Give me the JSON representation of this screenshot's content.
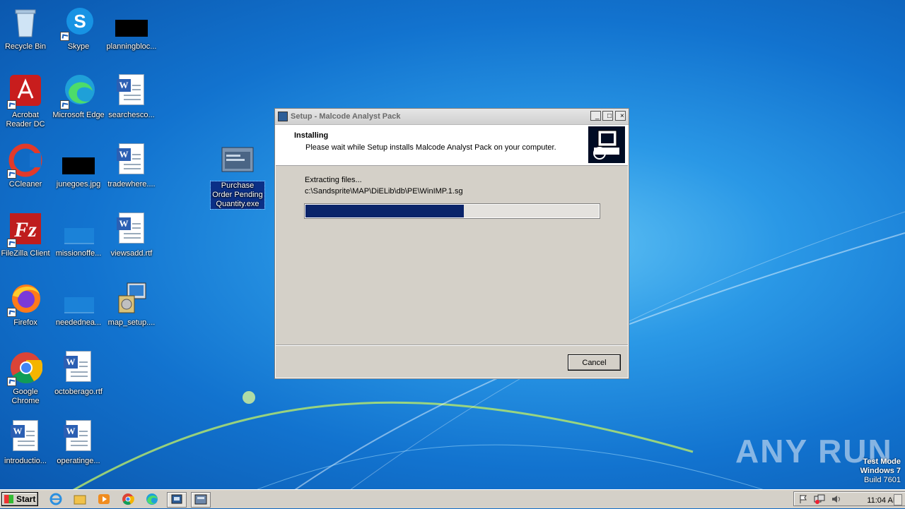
{
  "desktop": {
    "icons": [
      {
        "label": "Recycle Bin",
        "icon": "recycle-bin-icon"
      },
      {
        "label": "Skype",
        "icon": "skype-icon"
      },
      {
        "label": "planningbloc...",
        "icon": "image-file-icon"
      },
      {
        "label": "Acrobat Reader DC",
        "icon": "acrobat-icon"
      },
      {
        "label": "Microsoft Edge",
        "icon": "edge-icon"
      },
      {
        "label": "searchesco...",
        "icon": "word-doc-icon"
      },
      {
        "label": "CCleaner",
        "icon": "ccleaner-icon"
      },
      {
        "label": "junegoes.jpg",
        "icon": "image-file-icon"
      },
      {
        "label": "tradewhere....",
        "icon": "word-doc-icon"
      },
      {
        "label": "Purchase Order Pending Quantity.exe",
        "icon": "exe-icon"
      },
      {
        "label": "FileZilla Client",
        "icon": "filezilla-icon"
      },
      {
        "label": "missionoffe...",
        "icon": "image-file-icon"
      },
      {
        "label": "viewsadd.rtf",
        "icon": "word-doc-icon"
      },
      {
        "label": "Firefox",
        "icon": "firefox-icon"
      },
      {
        "label": "neededneа...",
        "icon": "image-file-icon"
      },
      {
        "label": "map_setup....",
        "icon": "installer-icon"
      },
      {
        "label": "Google Chrome",
        "icon": "chrome-icon"
      },
      {
        "label": "octoberago.rtf",
        "icon": "word-doc-icon"
      },
      {
        "label": "introductio...",
        "icon": "word-doc-icon"
      },
      {
        "label": "operatinge...",
        "icon": "word-doc-icon"
      }
    ]
  },
  "dialog": {
    "title": "Setup - Malcode Analyst Pack",
    "header_title": "Installing",
    "header_subtitle": "Please wait while Setup installs Malcode Analyst Pack on your computer.",
    "status": "Extracting files...",
    "current_file": "c:\\Sandsprite\\MAP\\DiELib\\db\\PE\\WinIMP.1.sg",
    "progress": 0.54,
    "cancel_label": "Cancel",
    "minimize_label": "_",
    "maximize_label": "□",
    "close_label": "×"
  },
  "watermark": {
    "text": "ANY RUN"
  },
  "system_info": {
    "line1": "Test Mode",
    "line2": "Windows 7",
    "line3": "Build 7601"
  },
  "taskbar": {
    "start_label": "Start",
    "clock": "11:04 AM",
    "quick_launch": [
      "ie-icon",
      "explorer-icon",
      "media-player-icon",
      "chrome-icon",
      "edge-icon",
      "setup-icon",
      "app-icon"
    ]
  }
}
